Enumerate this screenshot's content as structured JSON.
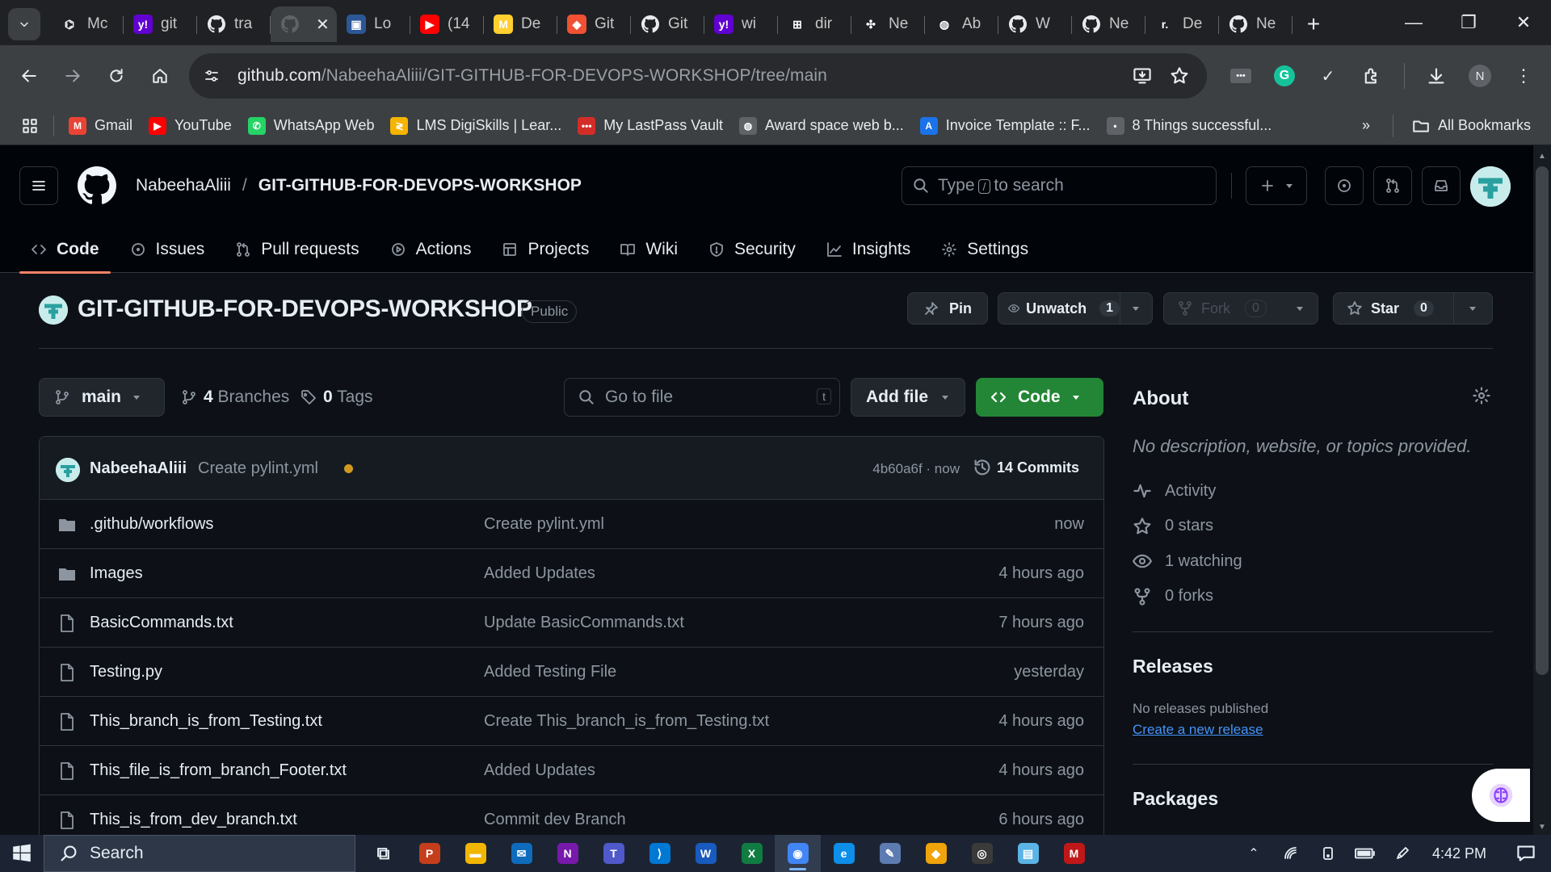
{
  "browser": {
    "tabs": [
      {
        "label": "Mc",
        "icon": "openai-icon",
        "color": "#202124",
        "glyph": "⌬"
      },
      {
        "label": "git",
        "icon": "yahoo-icon",
        "color": "#6001d2",
        "glyph": "y!"
      },
      {
        "label": "tra",
        "icon": "github-icon",
        "color": "#202124",
        "glyph": ""
      },
      {
        "label": "",
        "icon": "github-icon",
        "color": "#3c4043",
        "glyph": "",
        "active": true
      },
      {
        "label": "Lo",
        "icon": "login-icon",
        "color": "#2b5797",
        "glyph": "▣"
      },
      {
        "label": "(14",
        "icon": "youtube-icon",
        "color": "#ff0000",
        "glyph": "▶"
      },
      {
        "label": "De",
        "icon": "miro-icon",
        "color": "#ffd02f",
        "glyph": "M"
      },
      {
        "label": "Git",
        "icon": "git-icon",
        "color": "#f05033",
        "glyph": "◆"
      },
      {
        "label": "Git",
        "icon": "github-icon",
        "color": "#202124",
        "glyph": ""
      },
      {
        "label": "wi",
        "icon": "yahoo-icon",
        "color": "#6001d2",
        "glyph": "y!"
      },
      {
        "label": "dir",
        "icon": "microsoft-icon",
        "color": "#202124",
        "glyph": "⊞"
      },
      {
        "label": "Ne",
        "icon": "network-icon",
        "color": "#202124",
        "glyph": "✣"
      },
      {
        "label": "Ab",
        "icon": "globe-icon",
        "color": "#202124",
        "glyph": "◍"
      },
      {
        "label": "W",
        "icon": "github-icon",
        "color": "#202124",
        "glyph": ""
      },
      {
        "label": "Ne",
        "icon": "github-icon",
        "color": "#202124",
        "glyph": ""
      },
      {
        "label": "De",
        "icon": "devto-icon",
        "color": "#202124",
        "glyph": "r."
      },
      {
        "label": "Ne",
        "icon": "github-icon",
        "color": "#202124",
        "glyph": ""
      }
    ],
    "url_host": "github.com",
    "url_path": "/NabeehaAliii/GIT-GITHUB-FOR-DEVOPS-WORKSHOP/tree/main",
    "profile_initial": "N",
    "bookmarks": [
      {
        "label": "Gmail",
        "icon": "gmail-icon",
        "color": "#ea4335",
        "glyph": "M"
      },
      {
        "label": "YouTube",
        "icon": "youtube-icon",
        "color": "#ff0000",
        "glyph": "▶"
      },
      {
        "label": "WhatsApp Web",
        "icon": "whatsapp-icon",
        "color": "#25d366",
        "glyph": "✆"
      },
      {
        "label": "LMS DigiSkills | Lear...",
        "icon": "digiskills-icon",
        "color": "#f4b400",
        "glyph": "≷"
      },
      {
        "label": "My LastPass Vault",
        "icon": "lastpass-icon",
        "color": "#d32d27",
        "glyph": "•••"
      },
      {
        "label": "Award space web b...",
        "icon": "globe-icon",
        "color": "#5f6368",
        "glyph": "◍"
      },
      {
        "label": "Invoice Template :: F...",
        "icon": "invoice-icon",
        "color": "#1a73e8",
        "glyph": "A"
      },
      {
        "label": "8 Things successful...",
        "icon": "article-icon",
        "color": "#5f6368",
        "glyph": "▪"
      }
    ],
    "all_bookmarks": "All Bookmarks"
  },
  "github": {
    "owner": "NabeehaAliii",
    "repo": "GIT-GITHUB-FOR-DEVOPS-WORKSHOP",
    "search_prefix": "Type",
    "search_key": "/",
    "search_suffix": "to search",
    "nav": [
      {
        "label": "Code",
        "icon": "code-icon",
        "selected": true
      },
      {
        "label": "Issues",
        "icon": "issue-icon"
      },
      {
        "label": "Pull requests",
        "icon": "pull-request-icon"
      },
      {
        "label": "Actions",
        "icon": "play-icon"
      },
      {
        "label": "Projects",
        "icon": "table-icon"
      },
      {
        "label": "Wiki",
        "icon": "book-icon"
      },
      {
        "label": "Security",
        "icon": "shield-icon"
      },
      {
        "label": "Insights",
        "icon": "graph-icon"
      },
      {
        "label": "Settings",
        "icon": "gear-icon"
      }
    ],
    "visibility": "Public",
    "pin_label": "Pin",
    "watch_label": "Unwatch",
    "watch_count": "1",
    "fork_label": "Fork",
    "fork_count": "0",
    "star_label": "Star",
    "star_count": "0",
    "branch": "main",
    "branches_count": "4",
    "branches_label": "Branches",
    "tags_count": "0",
    "tags_label": "Tags",
    "goto_placeholder": "Go to file",
    "goto_key": "t",
    "add_file_label": "Add file",
    "code_label": "Code",
    "latest_commit": {
      "author": "NabeehaAliii",
      "message": "Create pylint.yml",
      "sha": "4b60a6f · now",
      "commits_count": "14 Commits"
    },
    "files": [
      {
        "name": ".github/workflows",
        "type": "folder",
        "message": "Create pylint.yml",
        "age": "now"
      },
      {
        "name": "Images",
        "type": "folder",
        "message": "Added Updates",
        "age": "4 hours ago"
      },
      {
        "name": "BasicCommands.txt",
        "type": "file",
        "message": "Update BasicCommands.txt",
        "age": "7 hours ago"
      },
      {
        "name": "Testing.py",
        "type": "file",
        "message": "Added Testing File",
        "age": "yesterday"
      },
      {
        "name": "This_branch_is_from_Testing.txt",
        "type": "file",
        "message": "Create This_branch_is_from_Testing.txt",
        "age": "4 hours ago"
      },
      {
        "name": "This_file_is_from_branch_Footer.txt",
        "type": "file",
        "message": "Added Updates",
        "age": "4 hours ago"
      },
      {
        "name": "This_is_from_dev_branch.txt",
        "type": "file",
        "message": "Commit dev Branch",
        "age": "6 hours ago"
      }
    ],
    "about": {
      "title": "About",
      "description": "No description, website, or topics provided.",
      "stats": [
        {
          "label": "Activity",
          "icon": "pulse-icon"
        },
        {
          "label": "0 stars",
          "icon": "star-icon"
        },
        {
          "label": "1 watching",
          "icon": "eye-icon"
        },
        {
          "label": "0 forks",
          "icon": "fork-icon"
        }
      ]
    },
    "releases": {
      "title": "Releases",
      "none": "No releases published",
      "link": "Create a new release"
    },
    "packages_title": "Packages"
  },
  "taskbar": {
    "search_label": "Search",
    "apps": [
      {
        "name": "taskview-icon",
        "color": "transparent",
        "glyph": "⧉"
      },
      {
        "name": "powerpoint-icon",
        "color": "#c43e1c",
        "glyph": "P"
      },
      {
        "name": "file-explorer-icon",
        "color": "#f2b600",
        "glyph": "▬"
      },
      {
        "name": "mail-icon",
        "color": "#0f6cbd",
        "glyph": "✉"
      },
      {
        "name": "onenote-icon",
        "color": "#7719aa",
        "glyph": "N"
      },
      {
        "name": "teams-icon",
        "color": "#5059c9",
        "glyph": "T"
      },
      {
        "name": "vscode-icon",
        "color": "#0078d4",
        "glyph": "⟩"
      },
      {
        "name": "word-icon",
        "color": "#185abd",
        "glyph": "W"
      },
      {
        "name": "excel-icon",
        "color": "#107c41",
        "glyph": "X"
      },
      {
        "name": "chrome-icon",
        "color": "#4285f4",
        "glyph": "◉",
        "active": true
      },
      {
        "name": "edge-icon",
        "color": "#0c8ee9",
        "glyph": "e"
      },
      {
        "name": "paint-icon",
        "color": "#5c7bb0",
        "glyph": "✎"
      },
      {
        "name": "sourcetree-icon",
        "color": "#f0a30a",
        "glyph": "◆"
      },
      {
        "name": "obs-icon",
        "color": "#3a3a3a",
        "glyph": "◎"
      },
      {
        "name": "notepad-icon",
        "color": "#5bb4e5",
        "glyph": "▤"
      },
      {
        "name": "mcafee-icon",
        "color": "#c01818",
        "glyph": "M"
      }
    ],
    "time": "4:42 PM"
  }
}
